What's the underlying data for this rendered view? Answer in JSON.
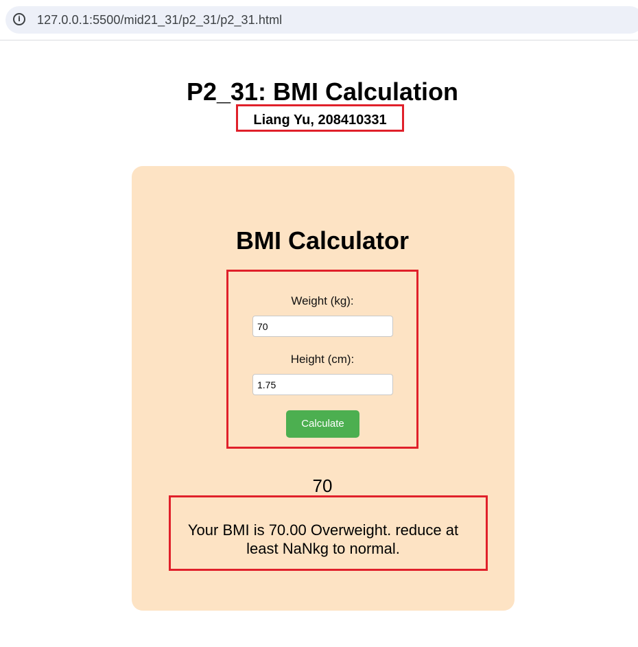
{
  "browser": {
    "url": "127.0.0.1:5500/mid21_31/p2_31/p2_31.html"
  },
  "page": {
    "title": "P2_31: BMI Calculation",
    "author": "Liang Yu, 208410331"
  },
  "calculator": {
    "title": "BMI Calculator",
    "weight_label": "Weight (kg):",
    "weight_value": "70",
    "height_label": "Height (cm):",
    "height_value": "1.75",
    "button_label": "Calculate"
  },
  "result": {
    "number": "70",
    "message": "Your BMI is 70.00 Overweight. reduce at least NaNkg to normal."
  },
  "colors": {
    "card_background": "#fde3c4",
    "button_green": "#4caf50",
    "highlight_red": "#e0202a"
  }
}
